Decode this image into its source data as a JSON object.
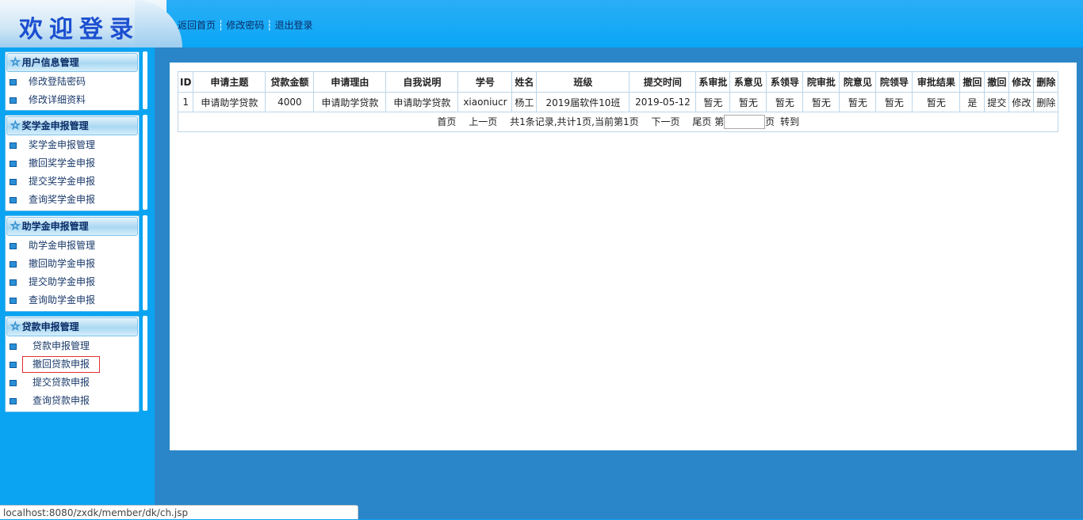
{
  "header": {
    "title": "欢迎登录",
    "links": [
      "返回首页",
      "修改密码",
      "退出登录"
    ],
    "separator": "┆"
  },
  "sidebar": {
    "panels": [
      {
        "title": "用户信息管理",
        "items": [
          "修改登陆密码",
          "修改详细资料"
        ]
      },
      {
        "title": "奖学金申报管理",
        "items": [
          "奖学金申报管理",
          "撤回奖学金申报",
          "提交奖学金申报",
          "查询奖学金申报"
        ]
      },
      {
        "title": "助学金申报管理",
        "items": [
          "助学金申报管理",
          "撤回助学金申报",
          "提交助学金申报",
          "查询助学金申报"
        ]
      },
      {
        "title": "贷款申报管理",
        "items": [
          "贷款申报管理",
          "撤回贷款申报",
          "提交贷款申报",
          "查询贷款申报"
        ]
      }
    ],
    "star_icon": "☆"
  },
  "table": {
    "columns": [
      "ID",
      "申请主题",
      "贷款金额",
      "申请理由",
      "自我说明",
      "学号",
      "姓名",
      "班级",
      "提交时间",
      "系审批",
      "系意见",
      "系领导",
      "院审批",
      "院意见",
      "院领导",
      "审批结果",
      "撤回",
      "撤回",
      "修改",
      "删除"
    ],
    "rows": [
      [
        "1",
        "申请助学贷款",
        "4000",
        "申请助学贷款",
        "申请助学贷款",
        "xiaoniucr",
        "杨工",
        "2019届软件10班",
        "2019-05-12",
        "暂无",
        "暂无",
        "暂无",
        "暂无",
        "暂无",
        "暂无",
        "暂无",
        "是",
        "提交",
        "修改",
        "删除"
      ]
    ]
  },
  "pager": {
    "first": "首页",
    "prev": "上一页",
    "summary": "共1条记录,共计1页,当前第1页",
    "next": "下一页",
    "last": "尾页",
    "page_prefix": "第",
    "page_input": "",
    "page_suffix": "页",
    "go": "转到"
  },
  "status_bar": "localhost:8080/zxdk/member/dk/ch.jsp"
}
